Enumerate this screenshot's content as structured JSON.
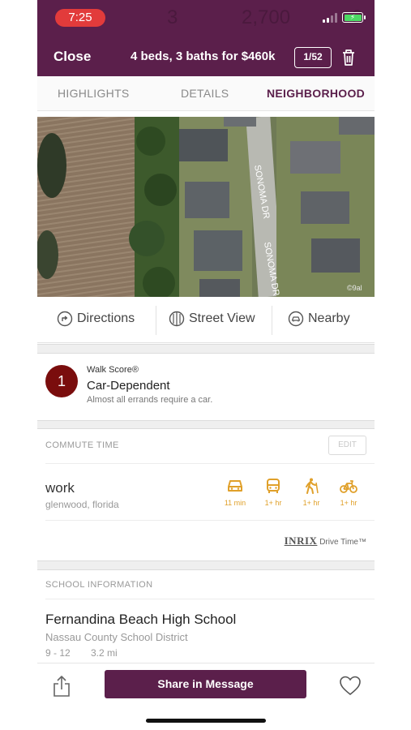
{
  "status_bar": {
    "time": "7:25",
    "ghost_left": "3",
    "ghost_right": "2,700",
    "ghost_end": "3"
  },
  "header": {
    "close_label": "Close",
    "title": "4 beds, 3 baths for $460k",
    "counter": "1/52"
  },
  "tabs": [
    {
      "label": "HIGHLIGHTS",
      "active": false
    },
    {
      "label": "DETAILS",
      "active": false
    },
    {
      "label": "NEIGHBORHOOD",
      "active": true
    }
  ],
  "map": {
    "street_name": "SONOMA DR",
    "watermark": "©9al"
  },
  "actions": [
    {
      "label": "Directions",
      "icon": "directions-icon"
    },
    {
      "label": "Street View",
      "icon": "street-view-icon"
    },
    {
      "label": "Nearby",
      "icon": "nearby-icon"
    }
  ],
  "walk_score": {
    "label": "Walk Score®",
    "score": "1",
    "title": "Car-Dependent",
    "description": "Almost all errands require a car."
  },
  "commute": {
    "heading": "COMMUTE TIME",
    "edit_label": "EDIT",
    "destination": "work",
    "location": "glenwood, florida",
    "modes": [
      {
        "icon": "car-icon",
        "time": "11 min"
      },
      {
        "icon": "bus-icon",
        "time": "1+ hr"
      },
      {
        "icon": "walk-icon",
        "time": "1+ hr"
      },
      {
        "icon": "bike-icon",
        "time": "1+ hr"
      }
    ],
    "accent_color": "#e0a02a",
    "provider": {
      "brand": "INRIX",
      "label": "Drive Time™"
    }
  },
  "school": {
    "heading": "SCHOOL INFORMATION",
    "name": "Fernandina Beach High School",
    "district": "Nassau County School District",
    "grades": "9 - 12",
    "distance": "3.2 mi"
  },
  "bottom_bar": {
    "share_label": "Share in Message"
  },
  "colors": {
    "brand": "#5b1f4b",
    "time_pill": "#e23b3b",
    "walk_score": "#7a0d0d"
  }
}
